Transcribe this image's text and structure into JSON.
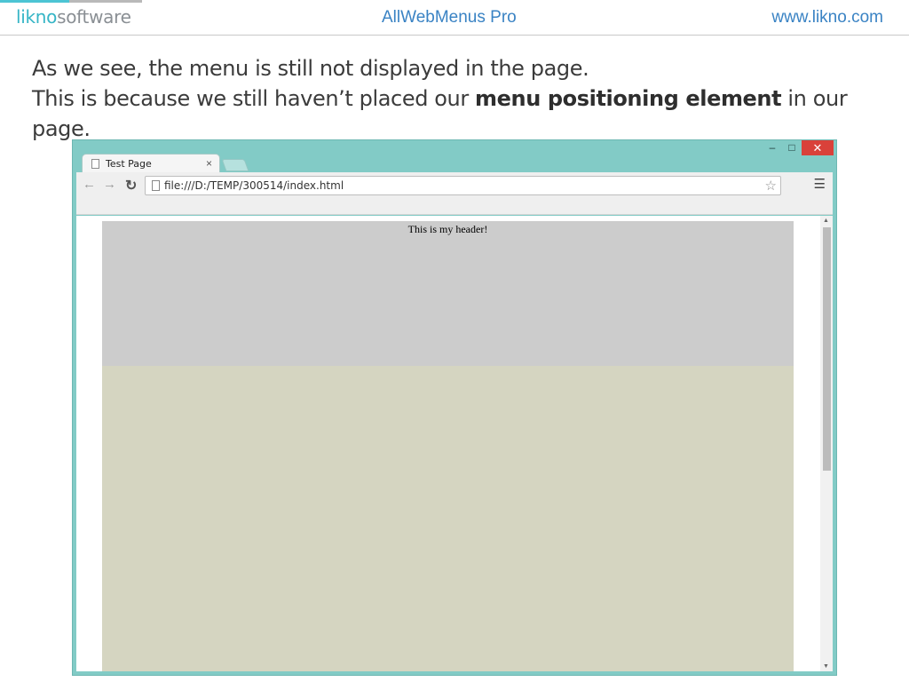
{
  "slide_header": {
    "logo_part1": "likno",
    "logo_part2": "software",
    "center_title": "AllWebMenus Pro",
    "website": "www.likno.com"
  },
  "slide_text": {
    "line1": "As we see, the menu is still not displayed in the page.",
    "line2_before": "This is because we still haven’t placed our ",
    "line2_bold": "menu positioning element",
    "line2_after": " in our page."
  },
  "browser": {
    "tab_title": "Test Page",
    "tab_close": "×",
    "url": "file:///D:/TEMP/300514/index.html",
    "window_controls": {
      "minimize": "–",
      "maximize": "□",
      "close": "✕"
    },
    "icons": {
      "back": "arrow-left-icon",
      "forward": "arrow-right-icon",
      "reload": "reload-icon",
      "bookmark": "star-icon",
      "menu": "hamburger-menu-icon"
    }
  },
  "page": {
    "header_text": "This is my header!"
  },
  "colors": {
    "accent": "#36b5c6",
    "header_link": "#3a83c4",
    "window_frame": "#82cbc6",
    "page_header_bg": "#cccccc",
    "page_body_bg": "#d5d5c1",
    "close_button": "#d9413a"
  }
}
